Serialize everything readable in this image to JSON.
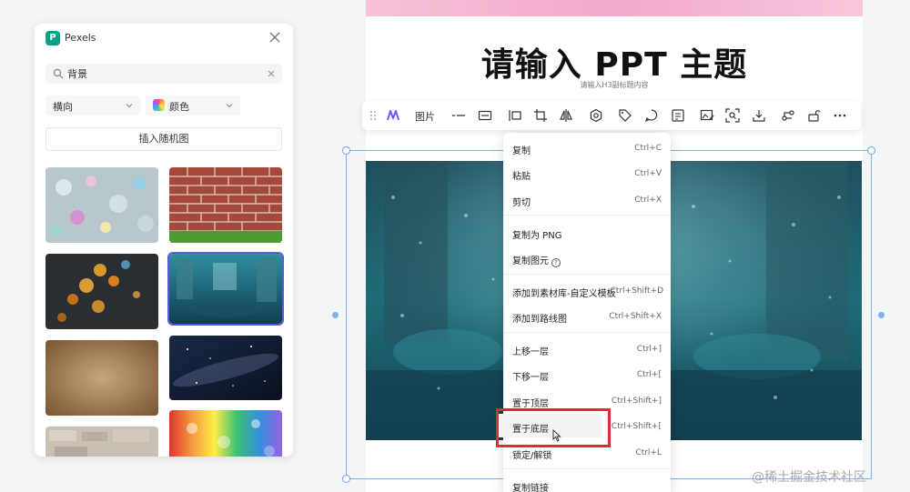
{
  "panel": {
    "title": "Pexels",
    "logo_letter": "P",
    "search_value": "背景",
    "orientation_label": "横向",
    "color_label": "颜色",
    "random_button": "插入随机图"
  },
  "slide": {
    "title": "请输入 PPT 主题",
    "subtitle": "请输入H3副标题内容"
  },
  "toolbar": {
    "image_label": "图片"
  },
  "menu": {
    "items": [
      {
        "label": "复制",
        "key": "Ctrl+C"
      },
      {
        "label": "粘贴",
        "key": "Ctrl+V"
      },
      {
        "label": "剪切",
        "key": "Ctrl+X"
      },
      {
        "label": "复制为 PNG",
        "key": ""
      },
      {
        "label": "复制图元",
        "key": ""
      },
      {
        "label": "添加到素材库-自定义模板",
        "key": "Ctrl+Shift+D"
      },
      {
        "label": "添加到路线图",
        "key": "Ctrl+Shift+X"
      },
      {
        "label": "上移一层",
        "key": "Ctrl+]"
      },
      {
        "label": "下移一层",
        "key": "Ctrl+["
      },
      {
        "label": "置于顶层",
        "key": "Ctrl+Shift+]"
      },
      {
        "label": "置于底层",
        "key": "Ctrl+Shift+["
      },
      {
        "label": "锁定/解锁",
        "key": "Ctrl+L"
      },
      {
        "label": "复制链接",
        "key": ""
      }
    ]
  },
  "watermark": "@稀土掘金技术社区",
  "colors": {
    "accent": "#5b5bd6",
    "selection": "#7fb0ef",
    "highlight": "#e02b35",
    "pexels": "#07a081"
  }
}
